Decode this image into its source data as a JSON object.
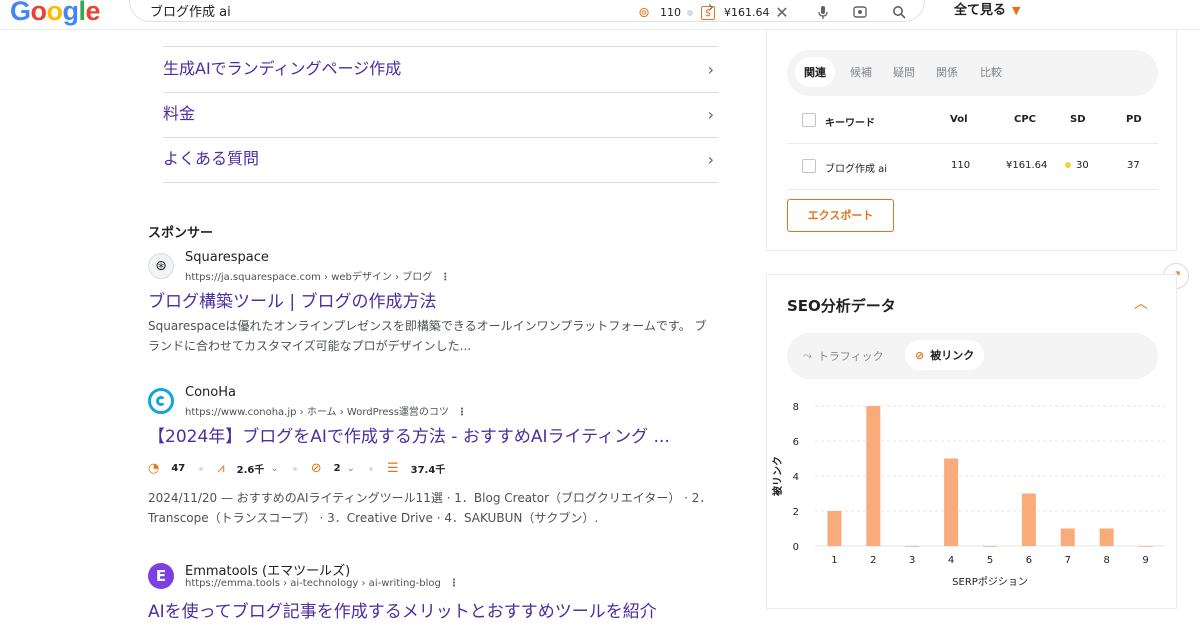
{
  "header": {
    "logo": "Google",
    "query": "ブログ作成 ai",
    "vol": "110",
    "cpc": "¥161.64",
    "all_view": "全て見る"
  },
  "nav_items": [
    {
      "label": "生成AIでランディングページ作成"
    },
    {
      "label": "料金"
    },
    {
      "label": "よくある質問"
    }
  ],
  "sponsor_label": "スポンサー",
  "results": [
    {
      "site": "Squarespace",
      "url": "https://ja.squarespace.com › webデザイン › ブログ",
      "title": "ブログ構築ツール | ブログの作成方法",
      "snippet1": "Squarespaceは優れたオンラインプレゼンスを即構築できるオールインワンプラットフォームです。 ブ",
      "snippet2": "ランドに合わせてカスタマイズ可能なプロがデザインした..."
    },
    {
      "site": "ConoHa",
      "url": "https://www.conoha.jp › ホーム › WordPress運営のコツ",
      "title": "【2024年】ブログをAIで作成する方法 - おすすめAIライティング ...",
      "metrics": {
        "m1": "47",
        "m2": "2.6千",
        "m3": "2",
        "m4": "37.4千"
      },
      "snippet1": "2024/11/20 — おすすめのAIライティングツール11選 · 1．Blog Creator（ブログクリエイター） · 2．",
      "snippet2": "Transcope（トランスコープ） · 3．Creative Drive · 4．SAKUBUN（サクブン）."
    },
    {
      "site": "Emmatools (エマツールズ)",
      "url": "https://emma.tools › ai-technology › ai-writing-blog",
      "title": "AIを使ってブログ記事を作成するメリットとおすすめツールを紹介"
    }
  ],
  "keyword_panel": {
    "tabs": [
      "関連",
      "候補",
      "疑問",
      "関係",
      "比較"
    ],
    "columns": {
      "keyword": "キーワード",
      "vol": "Vol",
      "cpc": "CPC",
      "sd": "SD",
      "pd": "PD"
    },
    "row": {
      "keyword": "ブログ作成 ai",
      "vol": "110",
      "cpc": "¥161.64",
      "sd": "30",
      "pd": "37"
    },
    "export": "エクスポート"
  },
  "seo_panel": {
    "title": "SEO分析データ",
    "tabs": [
      "トラフィック",
      "被リンク"
    ]
  },
  "colors": {
    "accent": "#e8711a",
    "bar": "#f9ab7c",
    "link": "#4b2ea1"
  },
  "chart_data": {
    "type": "bar",
    "xlabel": "SERPポジション",
    "ylabel": "被リンク",
    "categories": [
      "1",
      "2",
      "3",
      "4",
      "5",
      "6",
      "7",
      "8",
      "9"
    ],
    "values": [
      2,
      8,
      0,
      5,
      0,
      3,
      1,
      1,
      0
    ],
    "ylim": [
      0,
      8
    ],
    "yticks": [
      "0",
      "2",
      "4",
      "6",
      "8"
    ],
    "grid": true
  }
}
